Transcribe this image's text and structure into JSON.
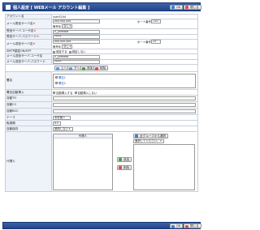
{
  "window": {
    "title": "個人設定 [ WEBメール アカウント編集 ]"
  },
  "toolbar": {
    "ok": "OK",
    "cancel": "閉じる"
  },
  "fields": {
    "account_name": {
      "label": "アカウント名",
      "value": "user5204"
    },
    "recv_server": {
      "label": "メール受信サーバ名",
      "value": "xxx.xxx.xxx",
      "port_label": "ポート番号",
      "port": "110",
      "enc_label": "暗号化",
      "enc": "なし"
    },
    "recv_user": {
      "label": "受信サーバ ユーザ名",
      "value": "k_yamada"
    },
    "recv_pass": {
      "label": "受信サーバ パスワード",
      "value": "*****"
    },
    "send_server": {
      "label": "メール送信サーバ名",
      "value": "xxx.xxx.xxx",
      "port_label": "ポート番号",
      "port": "25",
      "enc_label": "暗号化",
      "enc": "なし"
    },
    "smtp_auth": {
      "label": "SMTP認証ON/OFF",
      "on": "認証する",
      "off": "認証しない"
    },
    "send_user": {
      "label": "メール送信サーバ ユーザ名",
      "value": "k_yamada"
    },
    "send_pass": {
      "label": "メール送信サーバ パスワード",
      "value": "*****"
    },
    "sig_buttons": {
      "up": "上へ",
      "down": "下へ",
      "add": "追加",
      "del": "削除"
    },
    "signature": {
      "label": "署名",
      "items": [
        "署名1",
        "署名2"
      ]
    },
    "sig_auto": {
      "label": "署名自動挿入",
      "on": "自動挿入する",
      "off": "自動挿入しない"
    },
    "auto_to": {
      "label": "自動TO"
    },
    "auto_cc": {
      "label": "自動CC"
    },
    "auto_bcc": {
      "label": "自動BCC"
    },
    "theme": {
      "label": "テーマ",
      "value": "水彩画"
    },
    "sort": {
      "label": "転換順",
      "value": "0"
    },
    "auto_save": {
      "label": "自動保存",
      "value": "使用しない"
    },
    "delegate": {
      "label": "代理人",
      "list_label": "代理人",
      "group_button": "全グループから選択",
      "group_select": "選択してください。",
      "add": "追加",
      "del": "削除"
    }
  }
}
